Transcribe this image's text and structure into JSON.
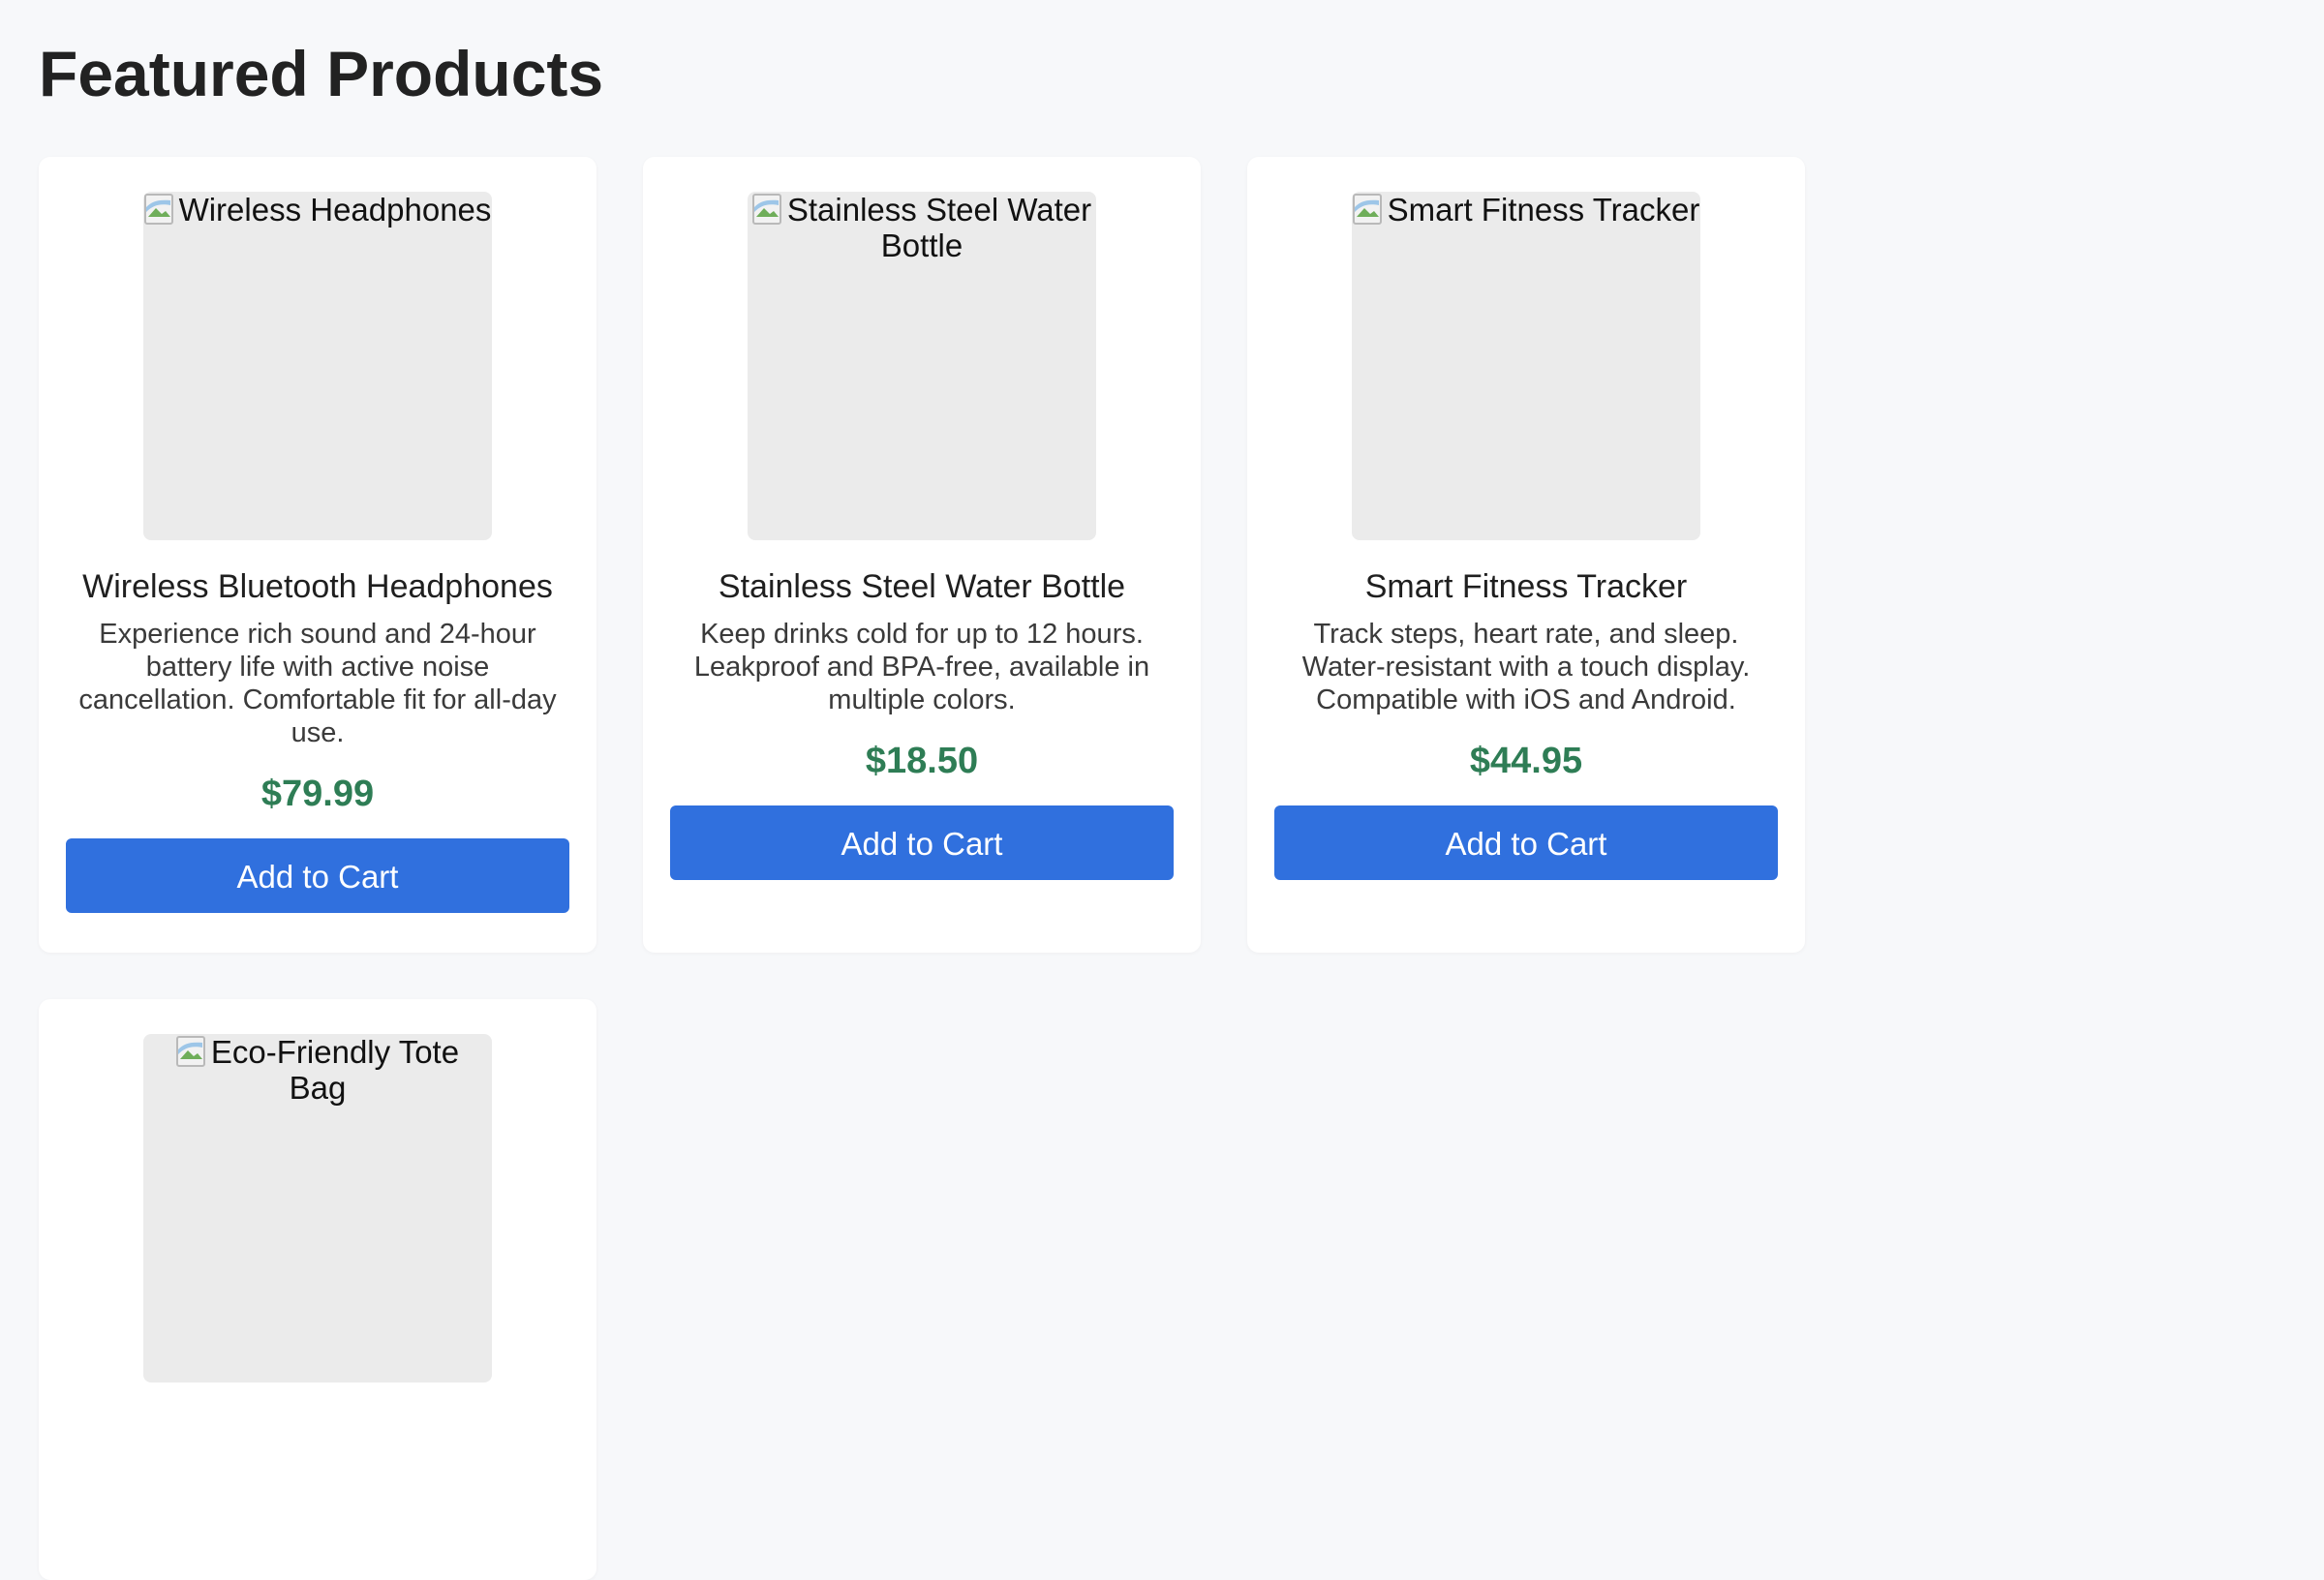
{
  "page": {
    "title": "Featured Products"
  },
  "products": [
    {
      "image_alt": "Wireless Headphones",
      "name": "Wireless Bluetooth Headphones",
      "description": "Experience rich sound and 24-hour battery life with active noise cancellation. Comfortable fit for all-day use.",
      "price": "$79.99",
      "button_label": "Add to Cart"
    },
    {
      "image_alt": "Stainless Steel Water Bottle",
      "name": "Stainless Steel Water Bottle",
      "description": "Keep drinks cold for up to 12 hours. Leakproof and BPA-free, available in multiple colors.",
      "price": "$18.50",
      "button_label": "Add to Cart"
    },
    {
      "image_alt": "Smart Fitness Tracker",
      "name": "Smart Fitness Tracker",
      "description": "Track steps, heart rate, and sleep. Water-resistant with a touch display. Compatible with iOS and Android.",
      "price": "$44.95",
      "button_label": "Add to Cart"
    },
    {
      "image_alt": "Eco-Friendly Tote Bag"
    }
  ],
  "colors": {
    "background": "#f7f8fa",
    "card": "#ffffff",
    "price": "#2e7d55",
    "button": "#3070de",
    "image_placeholder": "#ebebeb"
  }
}
